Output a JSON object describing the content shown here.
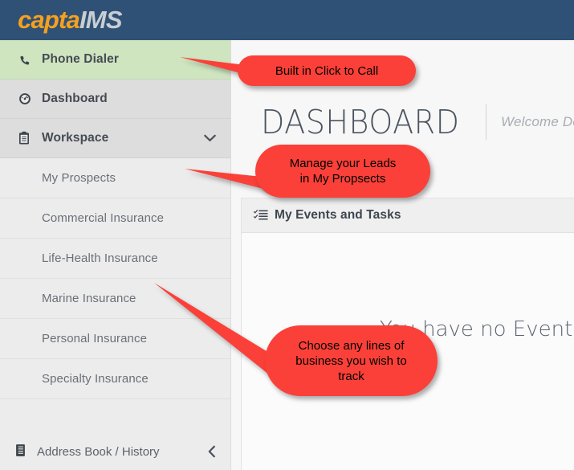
{
  "header": {
    "logo_primary": "capta",
    "logo_secondary": "IMS",
    "logo_primary_color": "#f5a01e",
    "logo_secondary_color": "#c9ced3",
    "background_color": "#2f5175"
  },
  "sidebar": {
    "background_color": "#ebebeb",
    "active_item_color": "#cfe5c0",
    "main_items": [
      {
        "label": "Phone Dialer",
        "icon": "phone-icon",
        "active": true,
        "chevron": null
      },
      {
        "label": "Dashboard",
        "icon": "tachometer-icon",
        "active": false,
        "chevron": null
      },
      {
        "label": "Workspace",
        "icon": "clipboard-icon",
        "active": false,
        "chevron": "chevron-down-icon"
      }
    ],
    "sub_items": [
      {
        "label": "My Prospects"
      },
      {
        "label": "Commercial Insurance"
      },
      {
        "label": "Life-Health Insurance"
      },
      {
        "label": "Marine Insurance"
      },
      {
        "label": "Personal Insurance"
      },
      {
        "label": "Specialty Insurance"
      }
    ],
    "bottom_item": {
      "label": "Address Book / History",
      "icon": "book-icon",
      "chevron": "chevron-left-icon"
    }
  },
  "main": {
    "page_title": "DASHBOARD",
    "welcome_text": "Welcome Demo",
    "panel": {
      "title": "My Events and Tasks",
      "icon": "task-list-icon",
      "empty_message": "You have no Events"
    }
  },
  "annotations": {
    "color": "#fa4038",
    "callouts": [
      {
        "text": "Built in Click to Call"
      },
      {
        "text": "Manage your Leads\nin My Propsects"
      },
      {
        "text": "Choose any lines of\nbusiness you wish to\ntrack"
      }
    ]
  }
}
